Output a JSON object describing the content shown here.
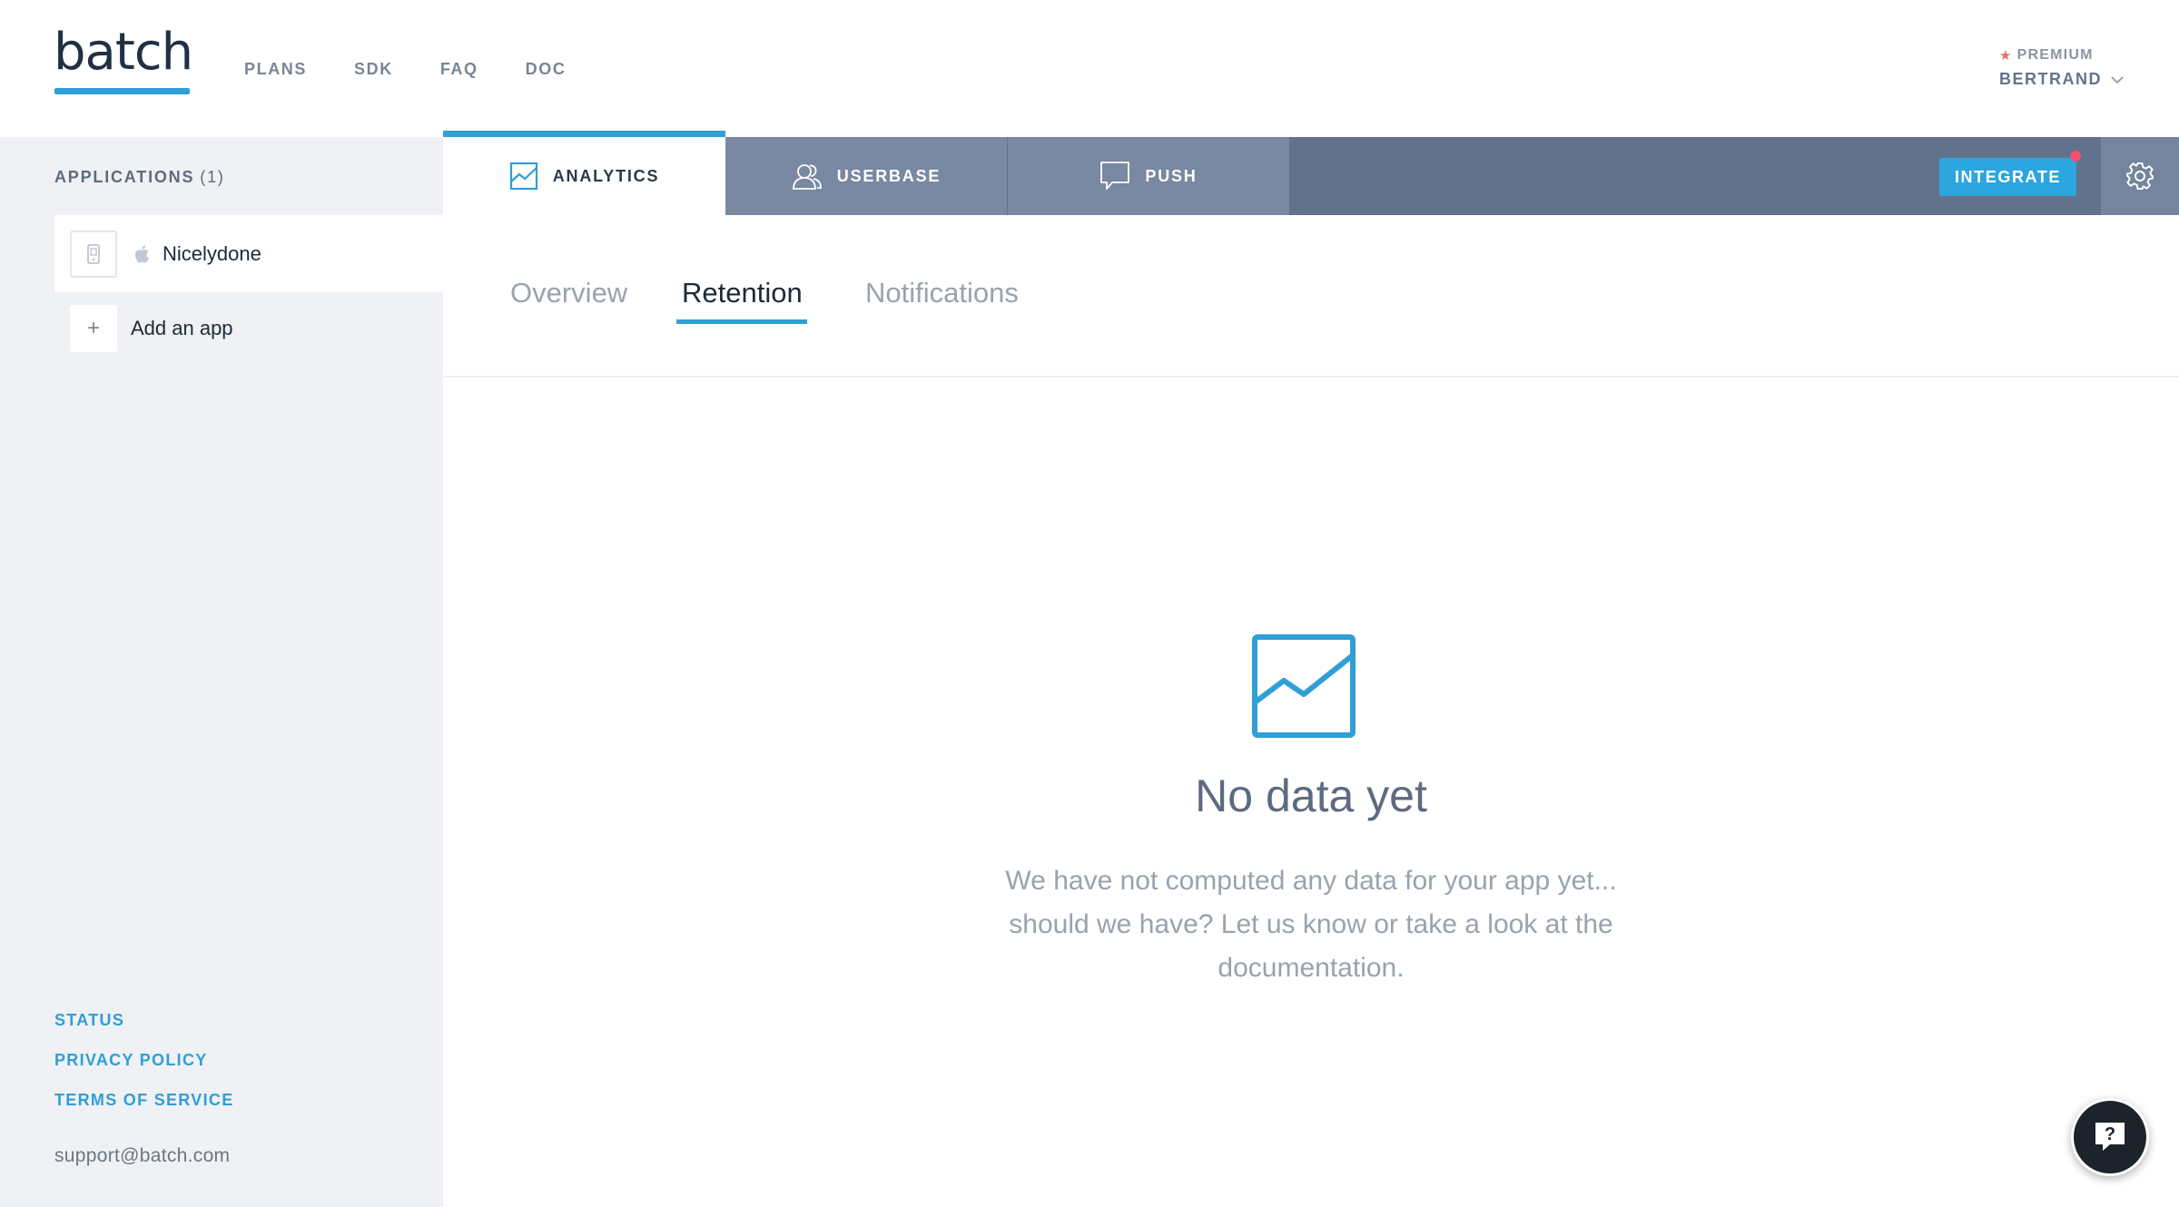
{
  "header": {
    "logo": "batch",
    "nav": [
      "PLANS",
      "SDK",
      "FAQ",
      "DOC"
    ],
    "user_tier": "PREMIUM",
    "user_name": "BERTRAND"
  },
  "sidebar": {
    "title": "APPLICATIONS",
    "count": "(1)",
    "apps": [
      {
        "name": "Nicelydone",
        "platform": "apple-icon"
      }
    ],
    "add_label": "Add an app",
    "add_symbol": "+",
    "links": [
      "STATUS",
      "PRIVACY POLICY",
      "TERMS OF SERVICE"
    ],
    "support_email": "support@batch.com"
  },
  "tabs": {
    "analytics": "ANALYTICS",
    "userbase": "USERBASE",
    "push": "PUSH",
    "integrate": "INTEGRATE"
  },
  "subtabs": {
    "overview": "Overview",
    "retention": "Retention",
    "notifications": "Notifications",
    "active": "Retention"
  },
  "empty_state": {
    "title": "No data yet",
    "line1": "We have not computed any data for your app yet...",
    "line2": "should we have? Let us know or take a look at the",
    "line3": "documentation."
  },
  "help": {
    "label": "?"
  },
  "colors": {
    "accent": "#2f9fd6",
    "tabbar": "#62728c",
    "inactive_tab": "#7889a1",
    "sidebar_bg": "#eff1f4",
    "notification_dot": "#f0506e"
  }
}
